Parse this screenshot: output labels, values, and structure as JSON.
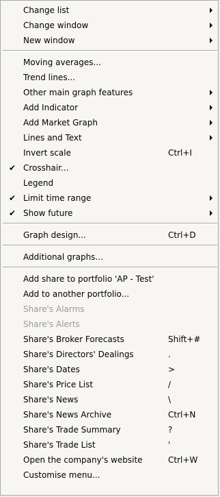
{
  "menu": {
    "groups": [
      [
        {
          "label": "Change list",
          "shortcut": "",
          "submenu": true,
          "checked": false,
          "disabled": false
        },
        {
          "label": "Change window",
          "shortcut": "",
          "submenu": true,
          "checked": false,
          "disabled": false
        },
        {
          "label": "New window",
          "shortcut": "",
          "submenu": true,
          "checked": false,
          "disabled": false
        }
      ],
      [
        {
          "label": "Moving averages...",
          "shortcut": "",
          "submenu": false,
          "checked": false,
          "disabled": false
        },
        {
          "label": "Trend lines...",
          "shortcut": "",
          "submenu": false,
          "checked": false,
          "disabled": false
        },
        {
          "label": "Other main graph features",
          "shortcut": "",
          "submenu": true,
          "checked": false,
          "disabled": false
        },
        {
          "label": "Add Indicator",
          "shortcut": "",
          "submenu": true,
          "checked": false,
          "disabled": false
        },
        {
          "label": "Add Market Graph",
          "shortcut": "",
          "submenu": true,
          "checked": false,
          "disabled": false
        },
        {
          "label": "Lines and Text",
          "shortcut": "",
          "submenu": true,
          "checked": false,
          "disabled": false
        },
        {
          "label": "Invert scale",
          "shortcut": "Ctrl+I",
          "submenu": false,
          "checked": false,
          "disabled": false
        },
        {
          "label": "Crosshair...",
          "shortcut": "",
          "submenu": false,
          "checked": true,
          "disabled": false
        },
        {
          "label": "Legend",
          "shortcut": "",
          "submenu": false,
          "checked": false,
          "disabled": false
        },
        {
          "label": "Limit time range",
          "shortcut": "",
          "submenu": true,
          "checked": true,
          "disabled": false
        },
        {
          "label": "Show future",
          "shortcut": "",
          "submenu": true,
          "checked": true,
          "disabled": false
        }
      ],
      [
        {
          "label": "Graph design...",
          "shortcut": "Ctrl+D",
          "submenu": false,
          "checked": false,
          "disabled": false
        }
      ],
      [
        {
          "label": "Additional graphs...",
          "shortcut": "",
          "submenu": false,
          "checked": false,
          "disabled": false
        }
      ],
      [
        {
          "label": "Add share to portfolio 'AP - Test'",
          "shortcut": "",
          "submenu": false,
          "checked": false,
          "disabled": false
        },
        {
          "label": "Add to another portfolio...",
          "shortcut": "",
          "submenu": false,
          "checked": false,
          "disabled": false
        },
        {
          "label": "Share's Alarms",
          "shortcut": "",
          "submenu": false,
          "checked": false,
          "disabled": true
        },
        {
          "label": "Share's Alerts",
          "shortcut": "",
          "submenu": false,
          "checked": false,
          "disabled": true
        },
        {
          "label": "Share's Broker Forecasts",
          "shortcut": "Shift+#",
          "submenu": false,
          "checked": false,
          "disabled": false
        },
        {
          "label": "Share's Directors' Dealings",
          "shortcut": ".",
          "submenu": false,
          "checked": false,
          "disabled": false
        },
        {
          "label": "Share's Dates",
          "shortcut": ">",
          "submenu": false,
          "checked": false,
          "disabled": false
        },
        {
          "label": "Share's Price List",
          "shortcut": "/",
          "submenu": false,
          "checked": false,
          "disabled": false
        },
        {
          "label": "Share's News",
          "shortcut": "\\",
          "submenu": false,
          "checked": false,
          "disabled": false
        },
        {
          "label": "Share's News Archive",
          "shortcut": "Ctrl+N",
          "submenu": false,
          "checked": false,
          "disabled": false
        },
        {
          "label": "Share's Trade Summary",
          "shortcut": "?",
          "submenu": false,
          "checked": false,
          "disabled": false
        },
        {
          "label": "Share's Trade List",
          "shortcut": "'",
          "submenu": false,
          "checked": false,
          "disabled": false
        },
        {
          "label": "Open the company's website",
          "shortcut": "Ctrl+W",
          "submenu": false,
          "checked": false,
          "disabled": false
        },
        {
          "label": "Customise menu...",
          "shortcut": "",
          "submenu": false,
          "checked": false,
          "disabled": false
        }
      ]
    ],
    "check_glyph": "✔",
    "colors": {
      "background": "#f7f6f2",
      "text": "#000000",
      "disabled_text": "#9a9a96",
      "separator": "#a8a8a4"
    }
  }
}
